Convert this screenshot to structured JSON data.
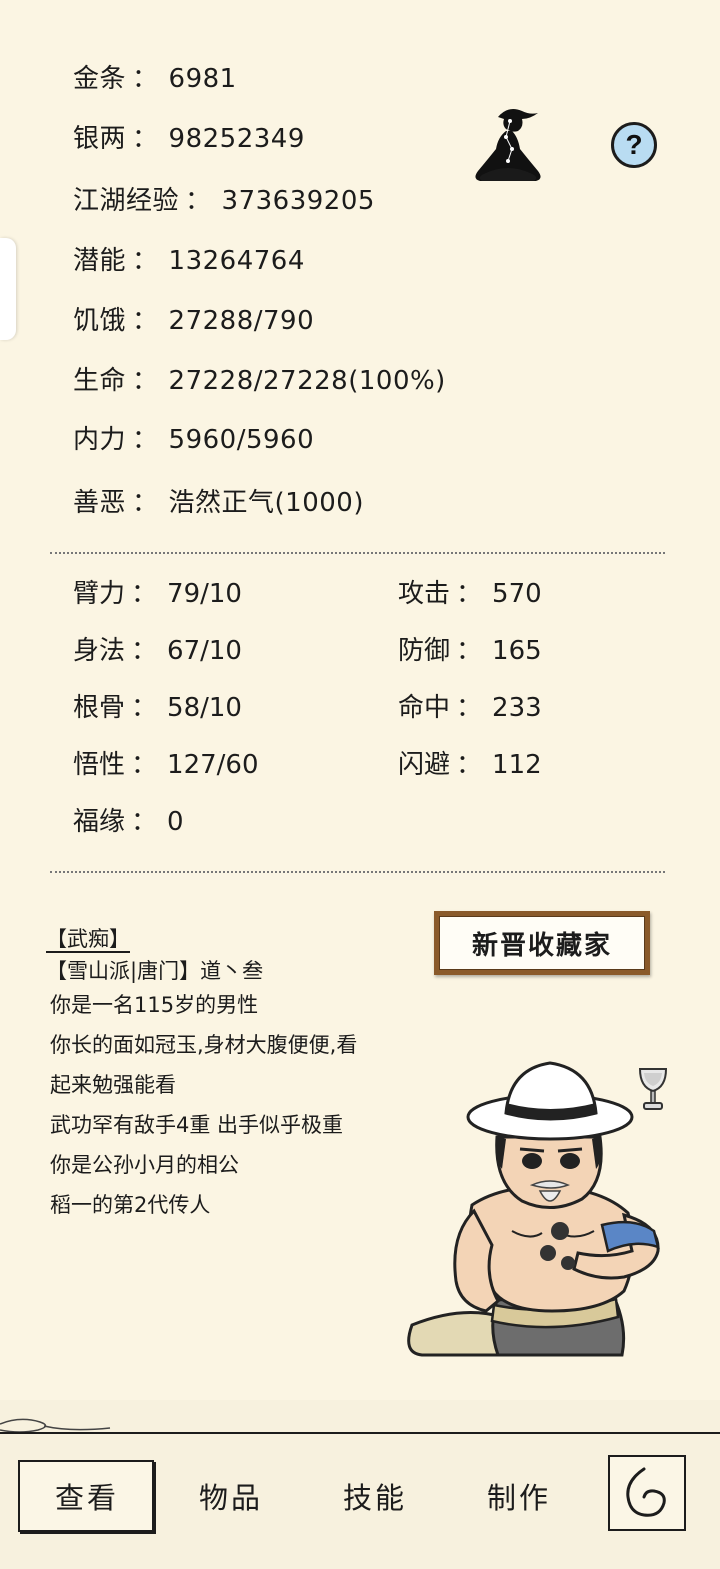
{
  "stats": {
    "gold": {
      "label": "金条",
      "value": "6981"
    },
    "silver": {
      "label": "银两",
      "value": "98252349"
    },
    "exp": {
      "label": "江湖经验",
      "value": "373639205"
    },
    "potential": {
      "label": "潜能",
      "value": "13264764"
    },
    "hunger": {
      "label": "饥饿",
      "value": "27288/790"
    },
    "life": {
      "label": "生命",
      "value": "27228/27228(100%)"
    },
    "inner": {
      "label": "内力",
      "value": "5960/5960"
    },
    "morality": {
      "label": "善恶",
      "value": "浩然正气(1000)"
    }
  },
  "separator": "：",
  "attributes": {
    "left": [
      {
        "label": "臂力",
        "value": "79/10"
      },
      {
        "label": "身法",
        "value": "67/10"
      },
      {
        "label": "根骨",
        "value": "58/10"
      },
      {
        "label": "悟性",
        "value": "127/60"
      },
      {
        "label": "福缘",
        "value": "0"
      }
    ],
    "right": [
      {
        "label": "攻击",
        "value": "570"
      },
      {
        "label": "防御",
        "value": "165"
      },
      {
        "label": "命中",
        "value": "233"
      },
      {
        "label": "闪避",
        "value": "112"
      }
    ]
  },
  "bio": {
    "title": "【武痴】",
    "lines": [
      "【雪山派|唐门】道丶叁",
      "你是一名115岁的男性",
      "你长的面如冠玉,身材大腹便便,看",
      "起来勉强能看",
      "武功罕有敌手4重 出手似乎极重",
      "你是公孙小月的相公",
      "稻一的第2代传人"
    ]
  },
  "plaque_text": "新晋收藏家",
  "help_icon": "?",
  "tabs": {
    "view": "查看",
    "items": "物品",
    "skills": "技能",
    "craft": "制作"
  },
  "icons": {
    "help": "question-icon",
    "meditate": "meditation-icon",
    "back": "back-arrow-icon",
    "trophy": "trophy-cup-icon"
  },
  "colors": {
    "background": "#fbf5e3",
    "help_fill": "#b9dcf2",
    "plaque_frame": "#8a5a2a"
  }
}
